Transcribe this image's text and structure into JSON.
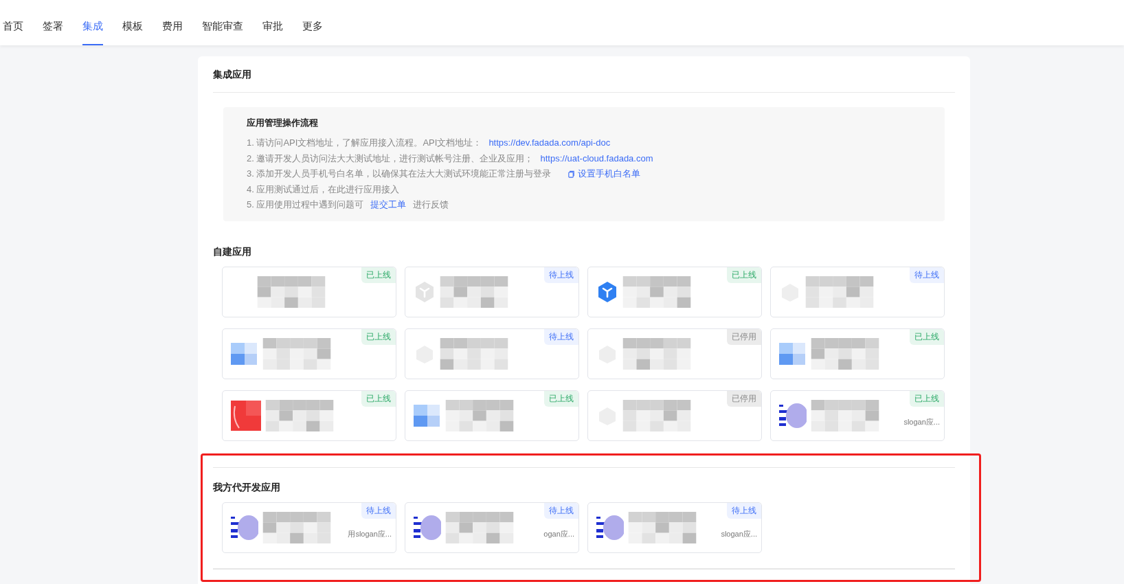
{
  "nav": [
    {
      "label": "首页",
      "selected": false
    },
    {
      "label": "签署",
      "selected": false
    },
    {
      "label": "集成",
      "selected": true
    },
    {
      "label": "模板",
      "selected": false
    },
    {
      "label": "费用",
      "selected": false
    },
    {
      "label": "智能审查",
      "selected": false
    },
    {
      "label": "审批",
      "selected": false
    },
    {
      "label": "更多",
      "selected": false
    }
  ],
  "panel_title": "集成应用",
  "guide": {
    "title": "应用管理操作流程",
    "steps": [
      {
        "text": "1. 请访问API文档地址，了解应用接入流程。API文档地址：",
        "link": "https://dev.fadada.com/api-doc",
        "link_icon": false
      },
      {
        "text": "2. 邀请开发人员访问法大大测试地址，进行测试帐号注册、企业及应用；",
        "link": "https://uat-cloud.fadada.com",
        "link_icon": false
      },
      {
        "text": "3. 添加开发人员手机号白名单，以确保其在法大大测试环境能正常注册与登录",
        "link": "设置手机白名单",
        "link_icon": true
      },
      {
        "text": "4. 应用测试通过后，在此进行应用接入",
        "link_icon": false
      },
      {
        "text": "5. 应用使用过程中遇到问题可",
        "link": "提交工单",
        "after": "进行反馈",
        "link_icon": false
      }
    ]
  },
  "sections": [
    {
      "title": "自建应用",
      "highlighted": false,
      "cards": [
        {
          "kind": "blank",
          "badge": {
            "kind": "online",
            "label": "已上线"
          }
        },
        {
          "kind": "hex-grey",
          "badge": {
            "kind": "pending",
            "label": "待上线"
          }
        },
        {
          "kind": "hex-blue",
          "badge": {
            "kind": "online",
            "label": "已上线"
          }
        },
        {
          "kind": "faint",
          "badge": {
            "kind": "pending",
            "label": "待上线"
          }
        },
        {
          "kind": "block-blue",
          "badge": {
            "kind": "online",
            "label": "已上线"
          }
        },
        {
          "kind": "faint",
          "badge": {
            "kind": "pending",
            "label": "待上线"
          }
        },
        {
          "kind": "faint",
          "badge": {
            "kind": "disabled",
            "label": "已停用"
          }
        },
        {
          "kind": "block-blue",
          "badge": {
            "kind": "online",
            "label": "已上线"
          }
        },
        {
          "kind": "block-red",
          "badge": {
            "kind": "online",
            "label": "已上线"
          }
        },
        {
          "kind": "block-blue",
          "badge": {
            "kind": "online",
            "label": "已上线"
          }
        },
        {
          "kind": "faint",
          "badge": {
            "kind": "disabled",
            "label": "已停用"
          }
        },
        {
          "kind": "fa-logo",
          "badge": {
            "kind": "online",
            "label": "已上线"
          },
          "snippet": "slogan应..."
        }
      ]
    },
    {
      "title": "我方代开发应用",
      "highlighted": true,
      "cards": [
        {
          "kind": "fa-logo",
          "badge": {
            "kind": "pending",
            "label": "待上线"
          },
          "snippet": "用slogan应..."
        },
        {
          "kind": "fa-logo",
          "badge": {
            "kind": "pending",
            "label": "待上线"
          },
          "snippet": "ogan应..."
        },
        {
          "kind": "fa-logo",
          "badge": {
            "kind": "pending",
            "label": "待上线"
          },
          "snippet": "slogan应..."
        }
      ]
    }
  ]
}
